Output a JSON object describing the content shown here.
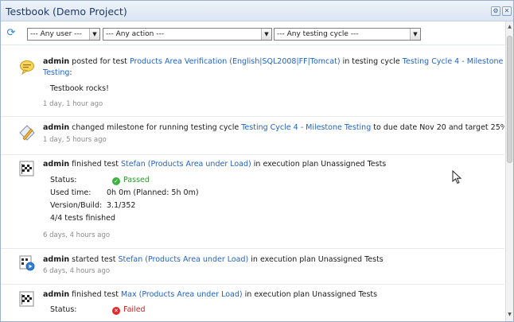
{
  "window": {
    "title": "Testbook (Demo Project)",
    "settings_icon": "gear-icon",
    "close_icon": "close-icon"
  },
  "filters": {
    "refresh_icon": "refresh-icon",
    "user": "--- Any user ---",
    "action": "--- Any action ---",
    "cycle": "--- Any testing cycle ---"
  },
  "feed": [
    {
      "icon": "comment-icon",
      "user": "admin",
      "t1": "posted for test",
      "link1": "Products Area Verification (English|SQL2008|FF|Tomcat)",
      "t2": "in testing cycle",
      "link2": "Testing Cycle 4 - Milestone",
      "link2b": "Testing",
      "t3": ":",
      "comment": "Testbook rocks!",
      "time": "1 day, 1 hour ago"
    },
    {
      "icon": "milestone-icon",
      "user": "admin",
      "t1": "changed milestone for running testing cycle",
      "link1": "Testing Cycle 4 - Milestone Testing",
      "t2": "to due date Nov 20 and target 25%",
      "time": "1 day, 5 hours ago"
    },
    {
      "icon": "finish-flag-icon",
      "user": "admin",
      "t1": "finished test",
      "link1": "Stefan (Products Area under Load)",
      "t2": "in execution plan Unassigned Tests",
      "status_label": "Status:",
      "status_value": "Passed",
      "used_label": "Used time:",
      "used_value": "0h 0m (Planned: 5h 0m)",
      "version_label": "Version/Build:",
      "version_value": "3.1/352",
      "tests_finished": "4/4 tests finished",
      "time": "6 days, 4 hours ago"
    },
    {
      "icon": "start-test-icon",
      "user": "admin",
      "t1": "started test",
      "link1": "Stefan (Products Area under Load)",
      "t2": "in execution plan Unassigned Tests",
      "time": "6 days, 4 hours ago"
    },
    {
      "icon": "finish-flag-icon",
      "user": "admin",
      "t1": "finished test",
      "link1": "Max (Products Area under Load)",
      "t2": "in execution plan Unassigned Tests",
      "status_label": "Status:",
      "status_value": "Failed"
    }
  ],
  "colors": {
    "link": "#1f63c6",
    "passed": "#3fb13f",
    "failed": "#e02a2a",
    "title": "#1f3a63"
  }
}
